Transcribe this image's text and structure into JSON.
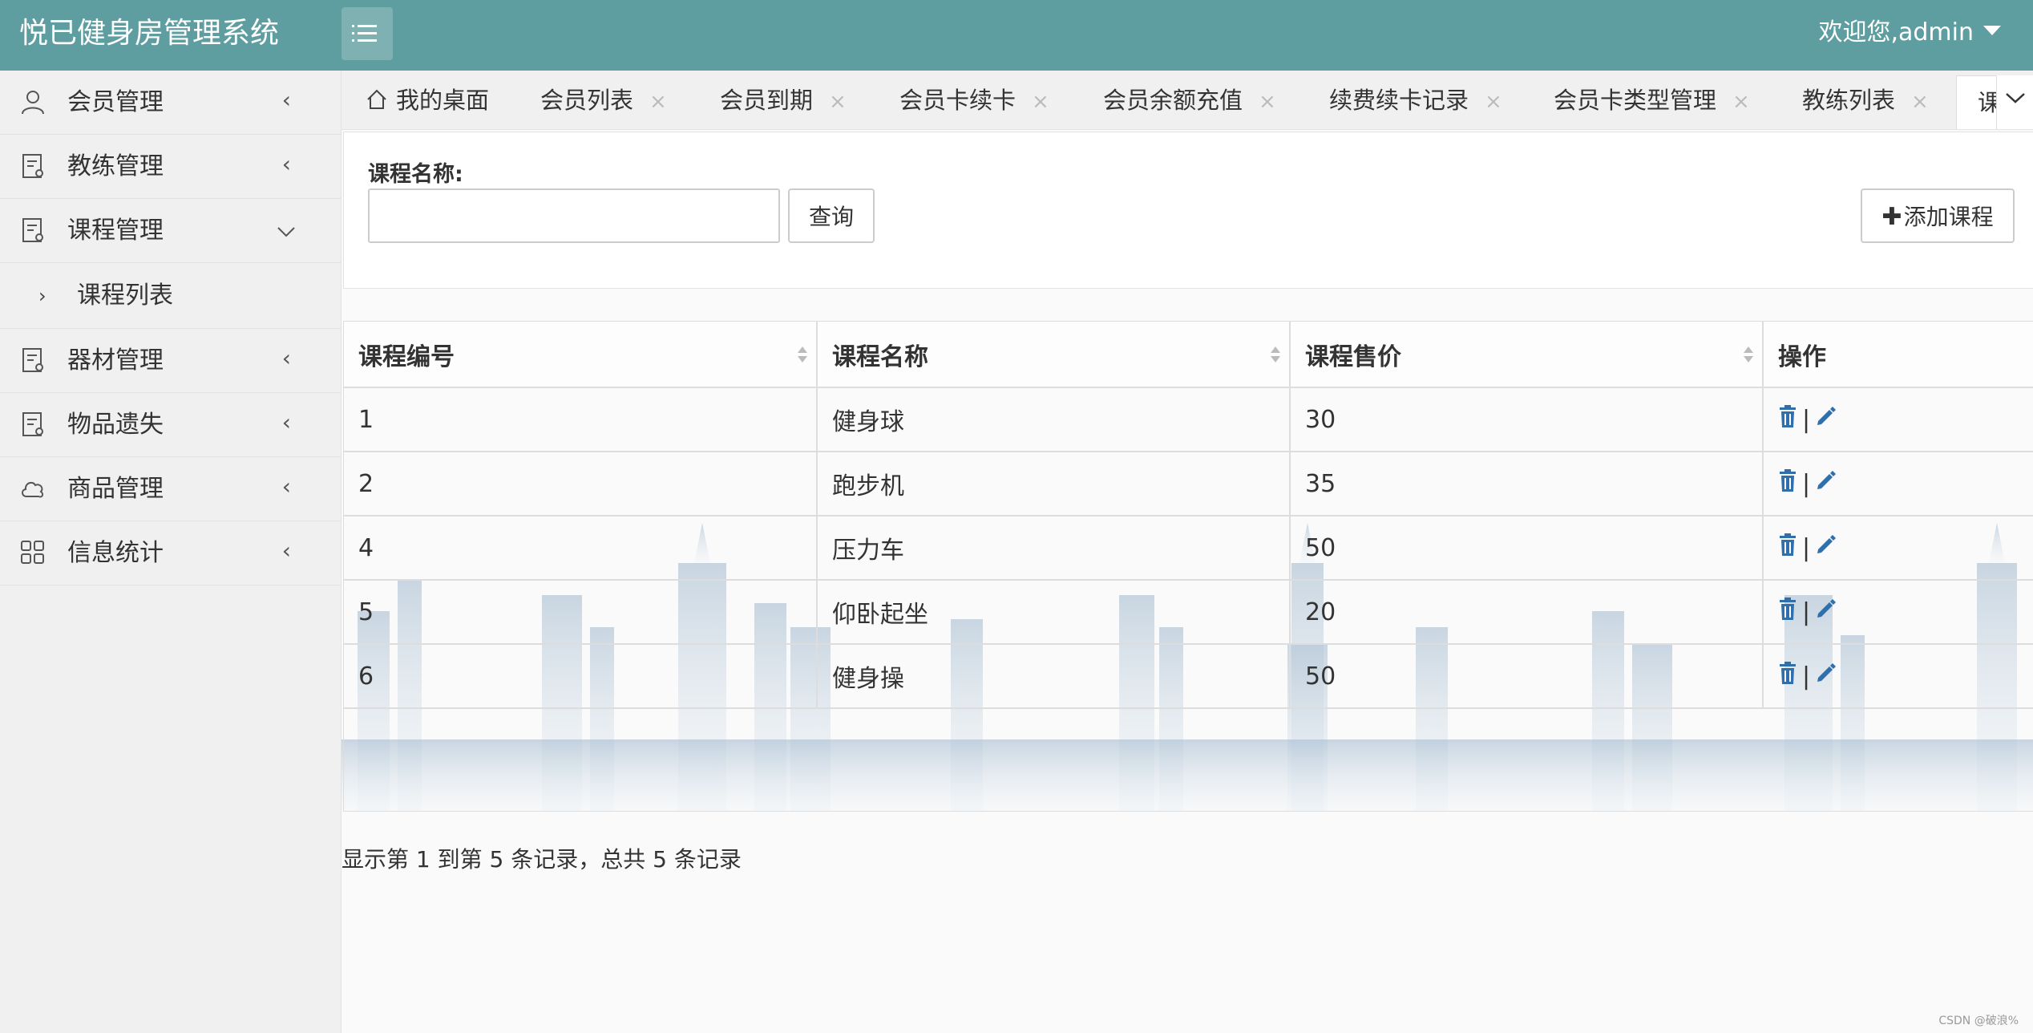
{
  "app": {
    "title": "悦已健身房管理系统",
    "welcome": "欢迎您,admin"
  },
  "colors": {
    "header_bg": "#5f9ea0",
    "icon_blue": "#2f6fab"
  },
  "sidebar": {
    "items": [
      {
        "label": "会员管理",
        "icon": "user-icon",
        "expanded": false
      },
      {
        "label": "教练管理",
        "icon": "document-icon",
        "expanded": false
      },
      {
        "label": "课程管理",
        "icon": "document-icon",
        "expanded": true,
        "children": [
          {
            "label": "课程列表"
          }
        ]
      },
      {
        "label": "器材管理",
        "icon": "document-icon",
        "expanded": false
      },
      {
        "label": "物品遗失",
        "icon": "document-icon",
        "expanded": false
      },
      {
        "label": "商品管理",
        "icon": "cloud-icon",
        "expanded": false
      },
      {
        "label": "信息统计",
        "icon": "grid-icon",
        "expanded": false
      }
    ]
  },
  "tabs": {
    "items": [
      {
        "label": "我的桌面",
        "closable": false,
        "icon": "home-icon"
      },
      {
        "label": "会员列表",
        "closable": true
      },
      {
        "label": "会员到期",
        "closable": true
      },
      {
        "label": "会员卡续卡",
        "closable": true
      },
      {
        "label": "会员余额充值",
        "closable": true
      },
      {
        "label": "续费续卡记录",
        "closable": true
      },
      {
        "label": "会员卡类型管理",
        "closable": true
      },
      {
        "label": "教练列表",
        "closable": true
      }
    ],
    "active_partial": "课",
    "close_glyph": "×"
  },
  "search": {
    "label": "课程名称:",
    "value": "",
    "query_button": "查询",
    "add_button": "添加课程"
  },
  "table": {
    "columns": [
      "课程编号",
      "课程名称",
      "课程售价",
      "操作"
    ],
    "rows": [
      {
        "id": "1",
        "name": "健身球",
        "price": "30"
      },
      {
        "id": "2",
        "name": "跑步机",
        "price": "35"
      },
      {
        "id": "4",
        "name": "压力车",
        "price": "50"
      },
      {
        "id": "5",
        "name": "仰卧起坐",
        "price": "20"
      },
      {
        "id": "6",
        "name": "健身操",
        "price": "50"
      }
    ],
    "op_separator": "|"
  },
  "pagination": {
    "summary": "显示第 1 到第 5 条记录，总共 5 条记录"
  },
  "footer": {
    "credit": "CSDN @破浪%"
  }
}
